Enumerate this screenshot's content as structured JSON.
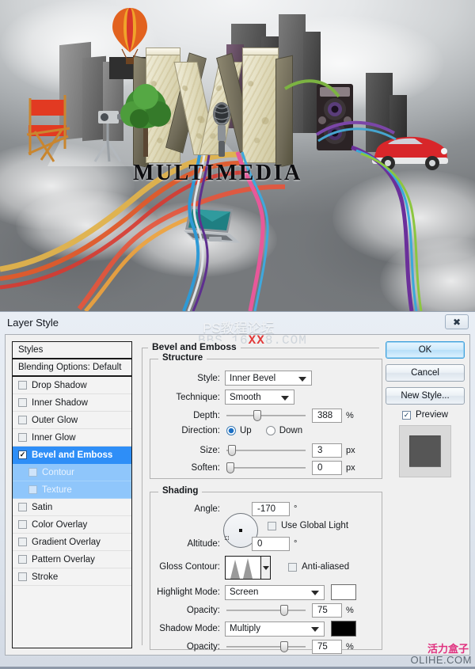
{
  "artwork": {
    "headline": "MULTIMEDIA",
    "alt": "multimedia 3d letters collage with balloon, city buildings, director chair, camera, tree, microphone, laptop, classic car and colored ribbons over clouds"
  },
  "watermarks": {
    "top_line1": "PS教程论坛",
    "top_line2_pre": "BBS.16",
    "top_line2_red": "XX",
    "top_line2_post": "8.COM",
    "bottom_line1": "活力盒子",
    "bottom_line2": "OLIHE.COM"
  },
  "dialog": {
    "title": "Layer Style",
    "close_icon": "close-icon",
    "styles_panel": {
      "header": "Styles",
      "blending_options": "Blending Options: Default",
      "items": [
        {
          "label": "Drop Shadow",
          "checked": false,
          "selected": false,
          "child": false
        },
        {
          "label": "Inner Shadow",
          "checked": false,
          "selected": false,
          "child": false
        },
        {
          "label": "Outer Glow",
          "checked": false,
          "selected": false,
          "child": false
        },
        {
          "label": "Inner Glow",
          "checked": false,
          "selected": false,
          "child": false
        },
        {
          "label": "Bevel and Emboss",
          "checked": true,
          "selected": true,
          "child": false
        },
        {
          "label": "Contour",
          "checked": false,
          "selected": false,
          "child": true
        },
        {
          "label": "Texture",
          "checked": false,
          "selected": false,
          "child": true
        },
        {
          "label": "Satin",
          "checked": false,
          "selected": false,
          "child": false
        },
        {
          "label": "Color Overlay",
          "checked": false,
          "selected": false,
          "child": false
        },
        {
          "label": "Gradient Overlay",
          "checked": false,
          "selected": false,
          "child": false
        },
        {
          "label": "Pattern Overlay",
          "checked": false,
          "selected": false,
          "child": false
        },
        {
          "label": "Stroke",
          "checked": false,
          "selected": false,
          "child": false
        }
      ]
    },
    "section_title": "Bevel and Emboss",
    "structure": {
      "legend": "Structure",
      "style_label": "Style:",
      "style_value": "Inner Bevel",
      "technique_label": "Technique:",
      "technique_value": "Smooth",
      "depth_label": "Depth:",
      "depth_value": "388",
      "depth_unit": "%",
      "depth_percent": 38,
      "direction_label": "Direction:",
      "direction_up": "Up",
      "direction_down": "Down",
      "direction_selected": "Up",
      "size_label": "Size:",
      "size_value": "3",
      "size_unit": "px",
      "size_percent": 2,
      "soften_label": "Soften:",
      "soften_value": "0",
      "soften_unit": "px",
      "soften_percent": 0
    },
    "shading": {
      "legend": "Shading",
      "angle_label": "Angle:",
      "angle_value": "-170",
      "angle_unit": "°",
      "use_global_light": "Use Global Light",
      "use_global_light_checked": false,
      "altitude_label": "Altitude:",
      "altitude_value": "0",
      "altitude_unit": "°",
      "gloss_contour_label": "Gloss Contour:",
      "anti_aliased": "Anti-aliased",
      "anti_aliased_checked": false,
      "highlight_mode_label": "Highlight Mode:",
      "highlight_mode_value": "Screen",
      "highlight_color": "#ffffff",
      "highlight_opacity_label": "Opacity:",
      "highlight_opacity_value": "75",
      "highlight_opacity_unit": "%",
      "highlight_opacity_percent": 75,
      "shadow_mode_label": "Shadow Mode:",
      "shadow_mode_value": "Multiply",
      "shadow_color": "#000000",
      "shadow_opacity_label": "Opacity:",
      "shadow_opacity_value": "75",
      "shadow_opacity_unit": "%",
      "shadow_opacity_percent": 75
    },
    "buttons": {
      "ok": "OK",
      "cancel": "Cancel",
      "new_style": "New Style...",
      "preview": "Preview",
      "preview_checked": true
    }
  },
  "colors": {
    "selection_blue": "#2e8ef7",
    "child_blue": "#8fc6fb",
    "dialog_bg": "#f0f0f0",
    "titlebar_bg": "#e3eaf2"
  }
}
